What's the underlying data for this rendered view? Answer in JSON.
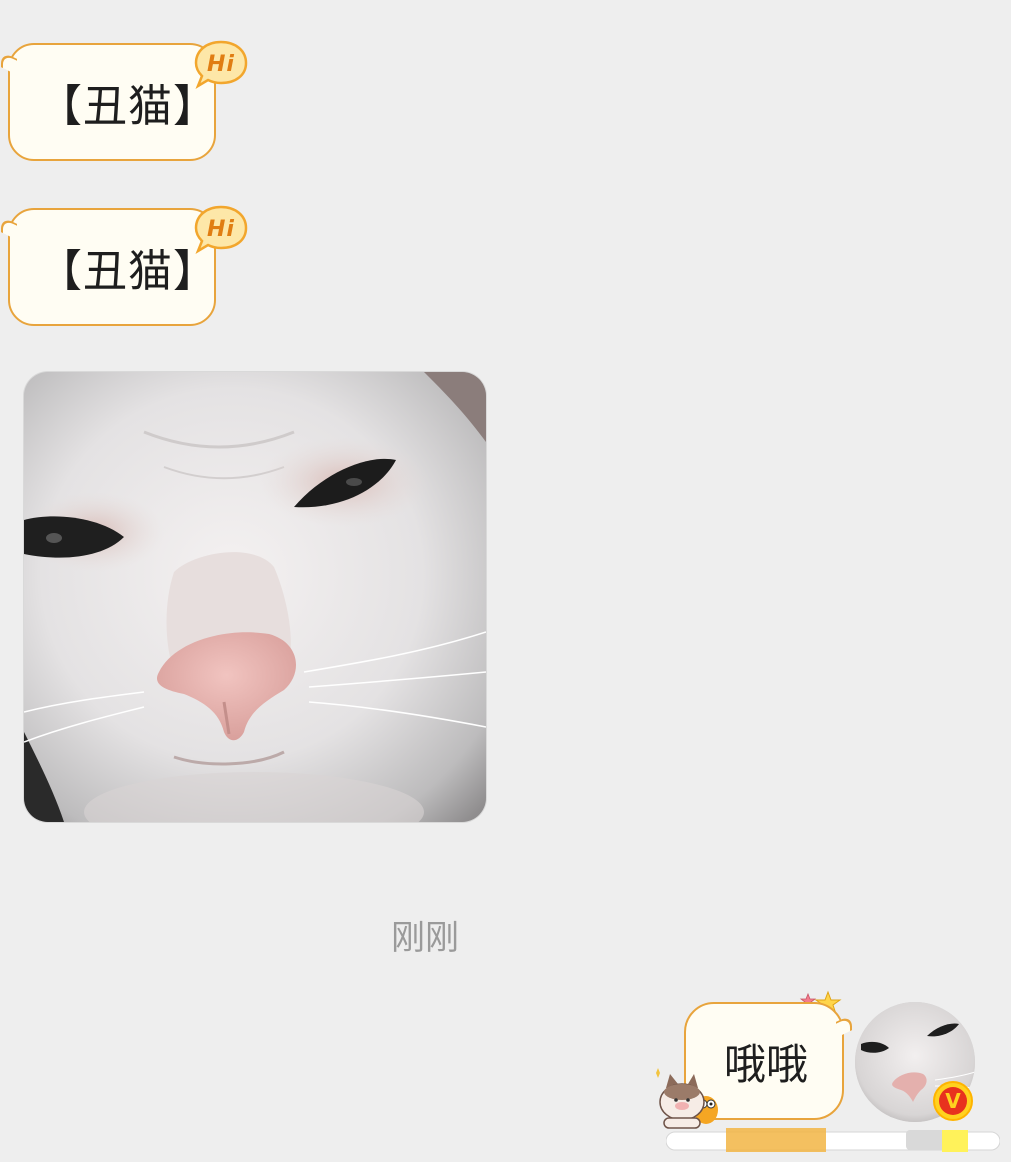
{
  "messages": {
    "received": [
      {
        "text": "【丑猫】",
        "badge": "Hi"
      },
      {
        "text": "【丑猫】",
        "badge": "Hi"
      }
    ],
    "image_message": {
      "icon": "cat-face-photo"
    },
    "timestamp": "刚刚",
    "sent": {
      "text": "哦哦"
    }
  },
  "avatar": {
    "icon": "cat-avatar",
    "badge": "V"
  },
  "colors": {
    "background": "#eeeeee",
    "bubble_fill": "#fffdf3",
    "bubble_border": "#e8a43c",
    "badge_orange": "#f7a51c",
    "vip_red": "#e8321e"
  }
}
